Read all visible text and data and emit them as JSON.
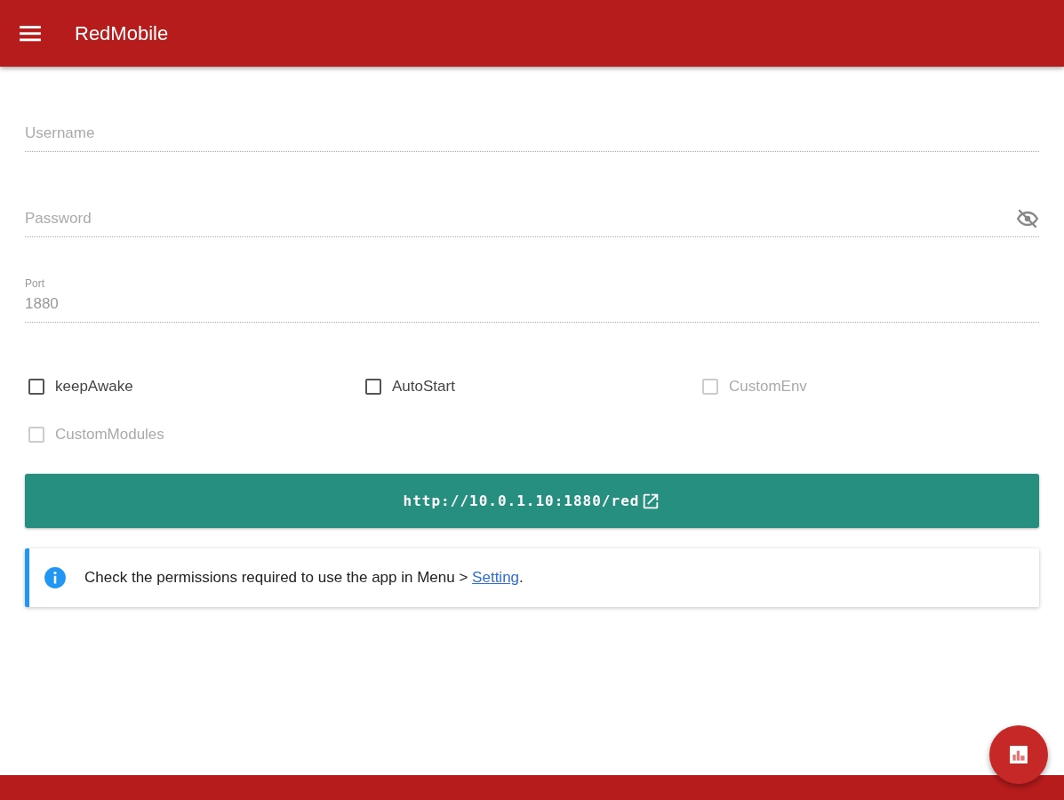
{
  "app_bar": {
    "title": "RedMobile"
  },
  "fields": [
    {
      "kind": "text",
      "placeholder": "Username"
    },
    {
      "kind": "password",
      "placeholder": "Password"
    },
    {
      "kind": "labeled",
      "label": "Port",
      "value": "1880"
    }
  ],
  "checkboxes": [
    {
      "label": "keepAwake",
      "checked": false,
      "disabled": false
    },
    {
      "label": "AutoStart",
      "checked": false,
      "disabled": false
    },
    {
      "label": "CustomEnv",
      "checked": false,
      "disabled": true
    },
    {
      "label": "CustomModules",
      "checked": false,
      "disabled": true
    }
  ],
  "url_button": {
    "label": "http://10.0.1.10:1880/red"
  },
  "info": {
    "text_before": "Check the permissions required to use the app in Menu > ",
    "link": "Setting",
    "text_after": "."
  }
}
